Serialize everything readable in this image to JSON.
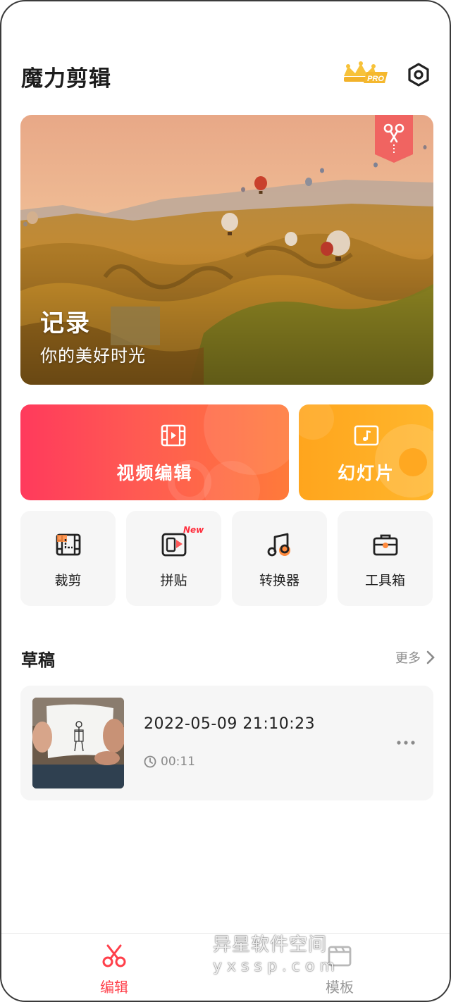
{
  "header": {
    "title": "魔力剪辑",
    "pro_badge_text": "PRO",
    "settings_icon": "gear-icon"
  },
  "hero": {
    "title": "记录",
    "subtitle": "你的美好时光",
    "ribbon_icon": "scissors-icon"
  },
  "actions": {
    "video_edit": "视频编辑",
    "slideshow": "幻灯片"
  },
  "tools": [
    {
      "label": "裁剪",
      "icon": "crop-film-icon"
    },
    {
      "label": "拼贴",
      "icon": "collage-icon",
      "badge": "New"
    },
    {
      "label": "转换器",
      "icon": "music-note-icon"
    },
    {
      "label": "工具箱",
      "icon": "toolbox-icon"
    }
  ],
  "drafts": {
    "title": "草稿",
    "more_label": "更多",
    "items": [
      {
        "date": "2022-05-09 21:10:23",
        "duration": "00:11"
      }
    ]
  },
  "bottom_nav": {
    "items": [
      {
        "label": "编辑",
        "active": true
      },
      {
        "label": "模板",
        "active": false
      }
    ]
  },
  "watermark": {
    "line1": "异星软件空间",
    "line2": "yxssp.com"
  },
  "colors": {
    "accent_red": "#ff3f4a",
    "video_gradient_start": "#ff3a5c",
    "video_gradient_end": "#ff7a3a",
    "slideshow_orange": "#ffa51d",
    "pro_gold": "#f5b82e",
    "card_bg": "#f6f6f6"
  }
}
